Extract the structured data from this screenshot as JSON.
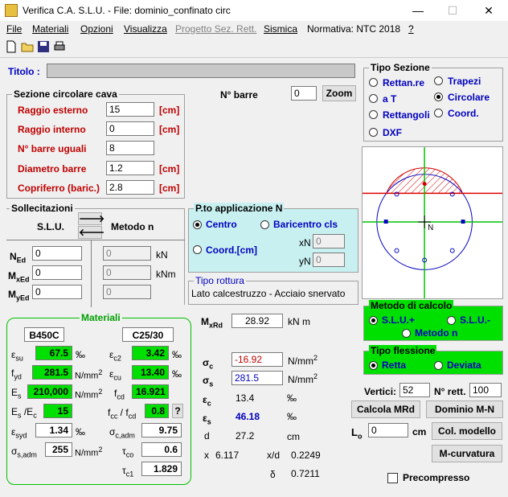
{
  "window": {
    "title": "Verifica C.A. S.L.U. - File: dominio_confinato circ",
    "minimize": "—",
    "maximize": "☐",
    "close": "✕"
  },
  "menu": [
    "File",
    "Materiali",
    "Opzioni",
    "Visualizza",
    "Progetto Sez. Rett.",
    "Sismica",
    "Normativa: NTC 2018",
    "?"
  ],
  "titolo": {
    "label": "Titolo :",
    "value": ""
  },
  "tipo_sezione": {
    "label": "Tipo Sezione",
    "options": [
      "Rettan.re",
      "Trapezi",
      "a T",
      "Circolare",
      "Rettangoli",
      "Coord.",
      "DXF"
    ],
    "selected": "Circolare"
  },
  "sezione": {
    "label": "Sezione circolare cava",
    "raggio_esterno": {
      "label": "Raggio esterno",
      "value": "15",
      "unit": "[cm]"
    },
    "raggio_interno": {
      "label": "Raggio interno",
      "value": "0",
      "unit": "[cm]"
    },
    "barre_uguali": {
      "label": "N° barre uguali",
      "value": "8"
    },
    "diametro": {
      "label": "Diametro barre",
      "value": "1.2",
      "unit": "[cm]"
    },
    "copriferro": {
      "label": "Copriferro (baric.)",
      "value": "2.8",
      "unit": "[cm]"
    }
  },
  "nbarre": {
    "label": "N° barre",
    "value": "0",
    "zoom": "Zoom"
  },
  "sollecitazioni": {
    "label": "Sollecitazioni",
    "slu": "S.L.U.",
    "metodo": "Metodo n",
    "ned": "0",
    "mxed": "0",
    "myed": "0",
    "n_n": "0",
    "m_n": "0",
    "o_n": "0",
    "unit_kn": "kN",
    "unit_knm": "kNm"
  },
  "pto_applicazione": {
    "label": "P.to applicazione N",
    "centro": "Centro",
    "baricentro": "Baricentro cls",
    "coord": "Coord.[cm]",
    "xn_label": "xN",
    "xn": "0",
    "yn_label": "yN",
    "yn": "0"
  },
  "tipo_rottura": {
    "label": "Tipo rottura",
    "value": "Lato calcestruzzo - Acciaio snervato"
  },
  "materiali": {
    "label": "Materiali",
    "acciaio": "B450C",
    "cls": "C25/30",
    "esu": "67.5",
    "ec2": "3.42",
    "fyd": "281.5",
    "ecu": "13.40",
    "es": "210,000",
    "fcd": "16.921",
    "es_ec": "15",
    "fcc_fcd": "0.8",
    "esyd": "1.34",
    "sc_adm": "9.75",
    "ss_adm": "255",
    "tco": "0.6",
    "tc1": "1.829",
    "permille": "‰",
    "nmm2": "N/mm",
    "q": "?"
  },
  "risultati": {
    "mxrd": "28.92",
    "mxrd_unit": "kN m",
    "sc": "-16.92",
    "ss": "281.5",
    "nmm2": "N/mm",
    "ec": "13.4",
    "es": "46.18",
    "permille": "‰",
    "d": "27.2",
    "d_unit": "cm",
    "x": "6.117",
    "x_d": "0.2249",
    "delta": "0.7211",
    "d_label": "d",
    "x_label": "x",
    "xd_label": "x/d"
  },
  "metodo_calcolo": {
    "label": "Metodo di calcolo",
    "options": [
      "S.L.U.+",
      "S.L.U.-",
      "Metodo n"
    ],
    "selected": "S.L.U.+"
  },
  "tipo_flessione": {
    "label": "Tipo flessione",
    "options": [
      "Retta",
      "Deviata"
    ],
    "selected": "Retta"
  },
  "vertici": {
    "label": "Vertici:",
    "value": "52",
    "nrett_label": "N° rett.",
    "nrett": "100"
  },
  "buttons": {
    "calcola": "Calcola MRd",
    "dominio": "Dominio M-N",
    "col_modello": "Col. modello",
    "m_curvatura": "M-curvatura"
  },
  "lo": {
    "label": "L",
    "value": "0",
    "unit": "cm"
  },
  "precompresso": "Precompresso",
  "diagram_label": "N"
}
